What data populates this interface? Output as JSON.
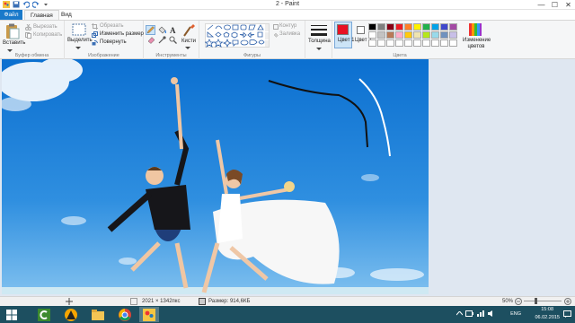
{
  "window": {
    "title": "2 - Paint",
    "controls": {
      "minimize": "—",
      "maximize": "☐",
      "close": "✕"
    }
  },
  "tabs": {
    "file": "Файл",
    "home": "Главная",
    "view": "Вид"
  },
  "ribbon": {
    "clipboard": {
      "paste": "Вставить",
      "cut": "Вырезать",
      "copy": "Копировать",
      "label": "Буфер обмена"
    },
    "image": {
      "select": "Выделить",
      "crop": "Обрезать",
      "resize": "Изменить размер",
      "rotate": "Повернуть",
      "label": "Изображение"
    },
    "tools": {
      "label": "Инструменты",
      "brushes": "Кисти"
    },
    "shapes": {
      "outline": "Контур",
      "fill": "Заливка",
      "label": "Фигуры"
    },
    "size": {
      "label": "Толщина"
    },
    "colors": {
      "color1": "Цвет 1",
      "color2": "Цвет 2",
      "edit": "Изменение цветов",
      "label": "Цвета",
      "color1_value": "#e81123",
      "color2_value": "#ffffff",
      "palette": [
        "#000000",
        "#7f7f7f",
        "#880015",
        "#ed1c24",
        "#ff7f27",
        "#fff200",
        "#22b14c",
        "#00a2e8",
        "#3f48cc",
        "#a349a4",
        "#ffffff",
        "#c3c3c3",
        "#b97a57",
        "#ffaec9",
        "#ffc90e",
        "#efe4b0",
        "#b5e61d",
        "#99d9ea",
        "#7092be",
        "#c8bfe7",
        "#ffffff",
        "#ffffff",
        "#ffffff",
        "#ffffff",
        "#ffffff",
        "#ffffff",
        "#ffffff",
        "#ffffff",
        "#ffffff",
        "#ffffff"
      ]
    }
  },
  "statusbar": {
    "dimensions": "2021 × 1342пкс",
    "filesize": "Размер: 914,6КБ",
    "zoom": "50%"
  },
  "taskbar": {
    "lang": "ENG",
    "time": "15:08",
    "date": "06.02.2015"
  }
}
